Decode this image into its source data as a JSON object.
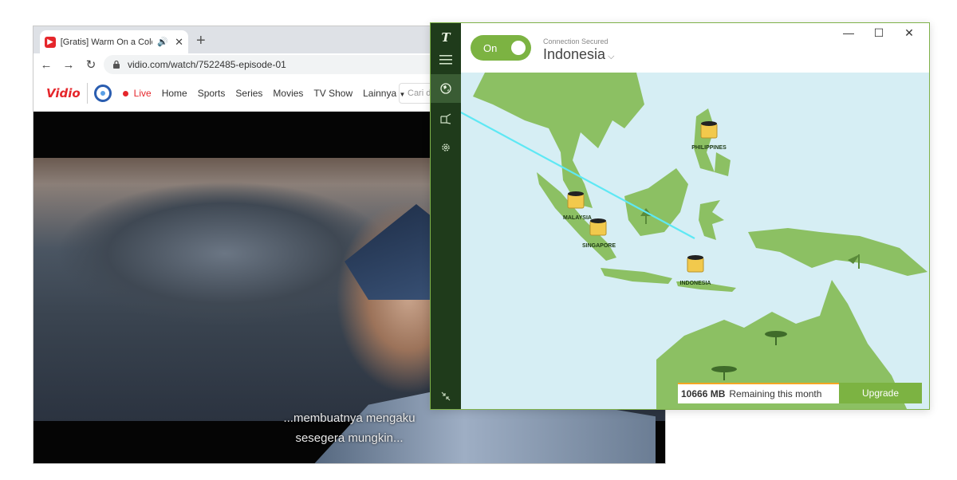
{
  "browser": {
    "tab_title": "[Gratis] Warm On a Cold Nig",
    "tab_favicon": "vidio-favicon",
    "tab_audio_icon": "🔊",
    "tab_close": "✕",
    "new_tab": "+",
    "back": "←",
    "forward": "→",
    "reload": "↻",
    "url": "vidio.com/watch/7522485-episode-01"
  },
  "site": {
    "logo": "Vidio",
    "nav": {
      "live": "Live",
      "home": "Home",
      "sports": "Sports",
      "series": "Series",
      "movies": "Movies",
      "tvshow": "TV Show",
      "more": "Lainnya"
    },
    "search_placeholder": "Cari d"
  },
  "video": {
    "subtitle_line1": "...membuatnya mengaku",
    "subtitle_line2": "sesegera mungkin..."
  },
  "vpn": {
    "brand_icon": "T",
    "toggle_label": "On",
    "status_text": "Connection Secured",
    "country": "Indonesia",
    "window_controls": {
      "minimize": "—",
      "maximize": "☐",
      "close": "✕"
    },
    "locations": [
      "PHILIPPINES",
      "MALAYSIA",
      "SINGAPORE",
      "INDONESIA"
    ],
    "data_remaining": "10666 MB",
    "data_label": "Remaining this month",
    "upgrade_label": "Upgrade",
    "colors": {
      "accent": "#7cb342",
      "sidebar": "#1f3b1b",
      "ocean": "#d6eef4",
      "land": "#8cc063",
      "route": "#5ee8f4"
    }
  }
}
